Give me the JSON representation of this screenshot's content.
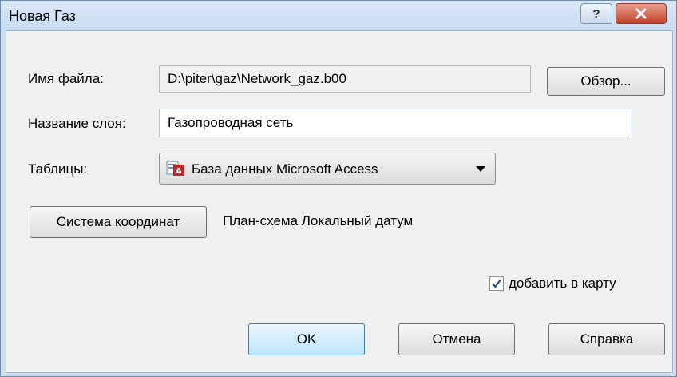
{
  "window": {
    "title": "Новая Газ"
  },
  "form": {
    "filename_label": "Имя файла:",
    "filename_value": "D:\\piter\\gaz\\Network_gaz.b00",
    "browse_label": "Обзор...",
    "layer_label": "Название слоя:",
    "layer_value": "Газопроводная сеть",
    "tables_label": "Таблицы:",
    "tables_selected": "База данных Microsoft Access",
    "coord_button": "Система координат",
    "coord_value": "План-схема Локальный датум",
    "add_to_map_label": "добавить в карту",
    "add_to_map_checked": true
  },
  "buttons": {
    "ok": "OK",
    "cancel": "Отмена",
    "help": "Справка"
  },
  "icons": {
    "help": "help-icon",
    "close": "close-icon",
    "access": "ms-access-icon",
    "dropdown": "chevron-down-icon",
    "check": "check-icon"
  },
  "colors": {
    "titlebar": "#c9dcf1",
    "close": "#c2432a",
    "dialog_bg": "#f0f0f0"
  }
}
